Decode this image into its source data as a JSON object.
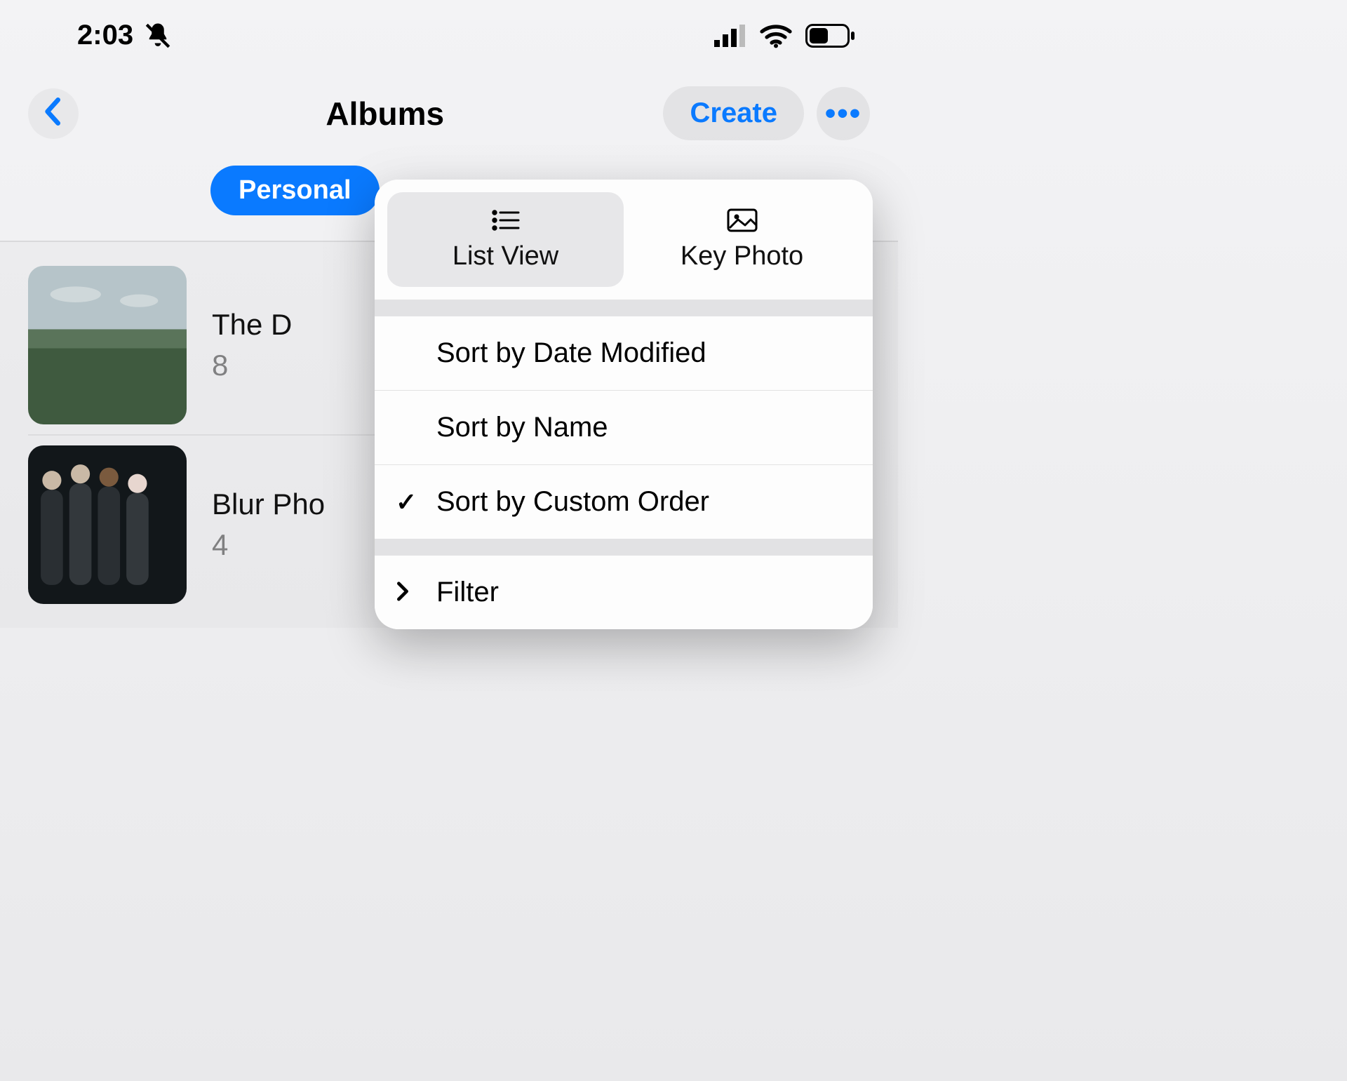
{
  "status": {
    "time": "2:03",
    "bell_muted": true
  },
  "nav": {
    "title": "Albums",
    "create_label": "Create"
  },
  "filter": {
    "selected_pill": "Personal"
  },
  "albums": [
    {
      "title": "The D",
      "count": "8"
    },
    {
      "title": "Blur Pho",
      "count": "4"
    }
  ],
  "popover": {
    "segments": {
      "list_view": "List View",
      "key_photo": "Key Photo",
      "active": "list_view"
    },
    "menu": {
      "sort_date_modified": "Sort by Date Modified",
      "sort_name": "Sort by Name",
      "sort_custom": "Sort by Custom Order",
      "filter": "Filter",
      "selected": "sort_custom"
    }
  },
  "colors": {
    "ios_blue": "#0a7aff"
  }
}
